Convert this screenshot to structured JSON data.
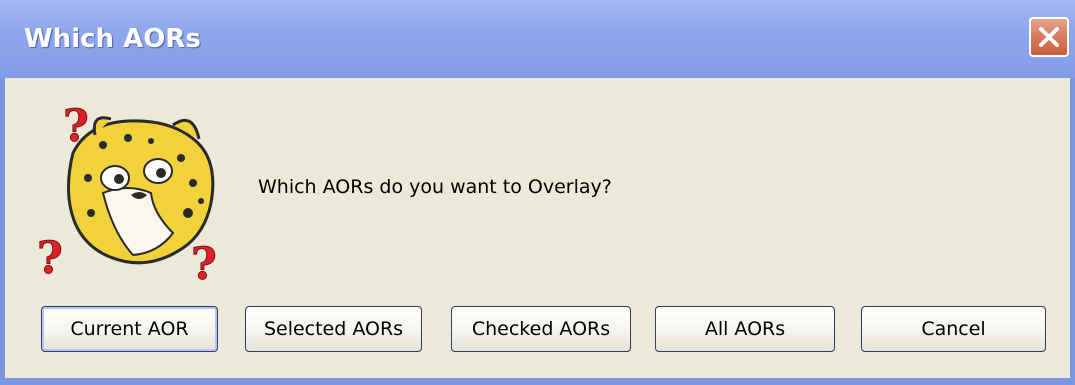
{
  "dialog": {
    "title": "Which AORs",
    "message": "Which AORs do you want to Overlay?",
    "icons": {
      "close": "close-icon",
      "image": "question-cheetah-icon"
    },
    "colors": {
      "titlebar": "#8ea6ec",
      "body": "#ece9d8",
      "close_button": "#d77a5e"
    },
    "buttons": [
      {
        "label": "Current AOR"
      },
      {
        "label": "Selected AORs"
      },
      {
        "label": "Checked AORs"
      },
      {
        "label": "All AORs"
      },
      {
        "label": "Cancel"
      }
    ]
  }
}
